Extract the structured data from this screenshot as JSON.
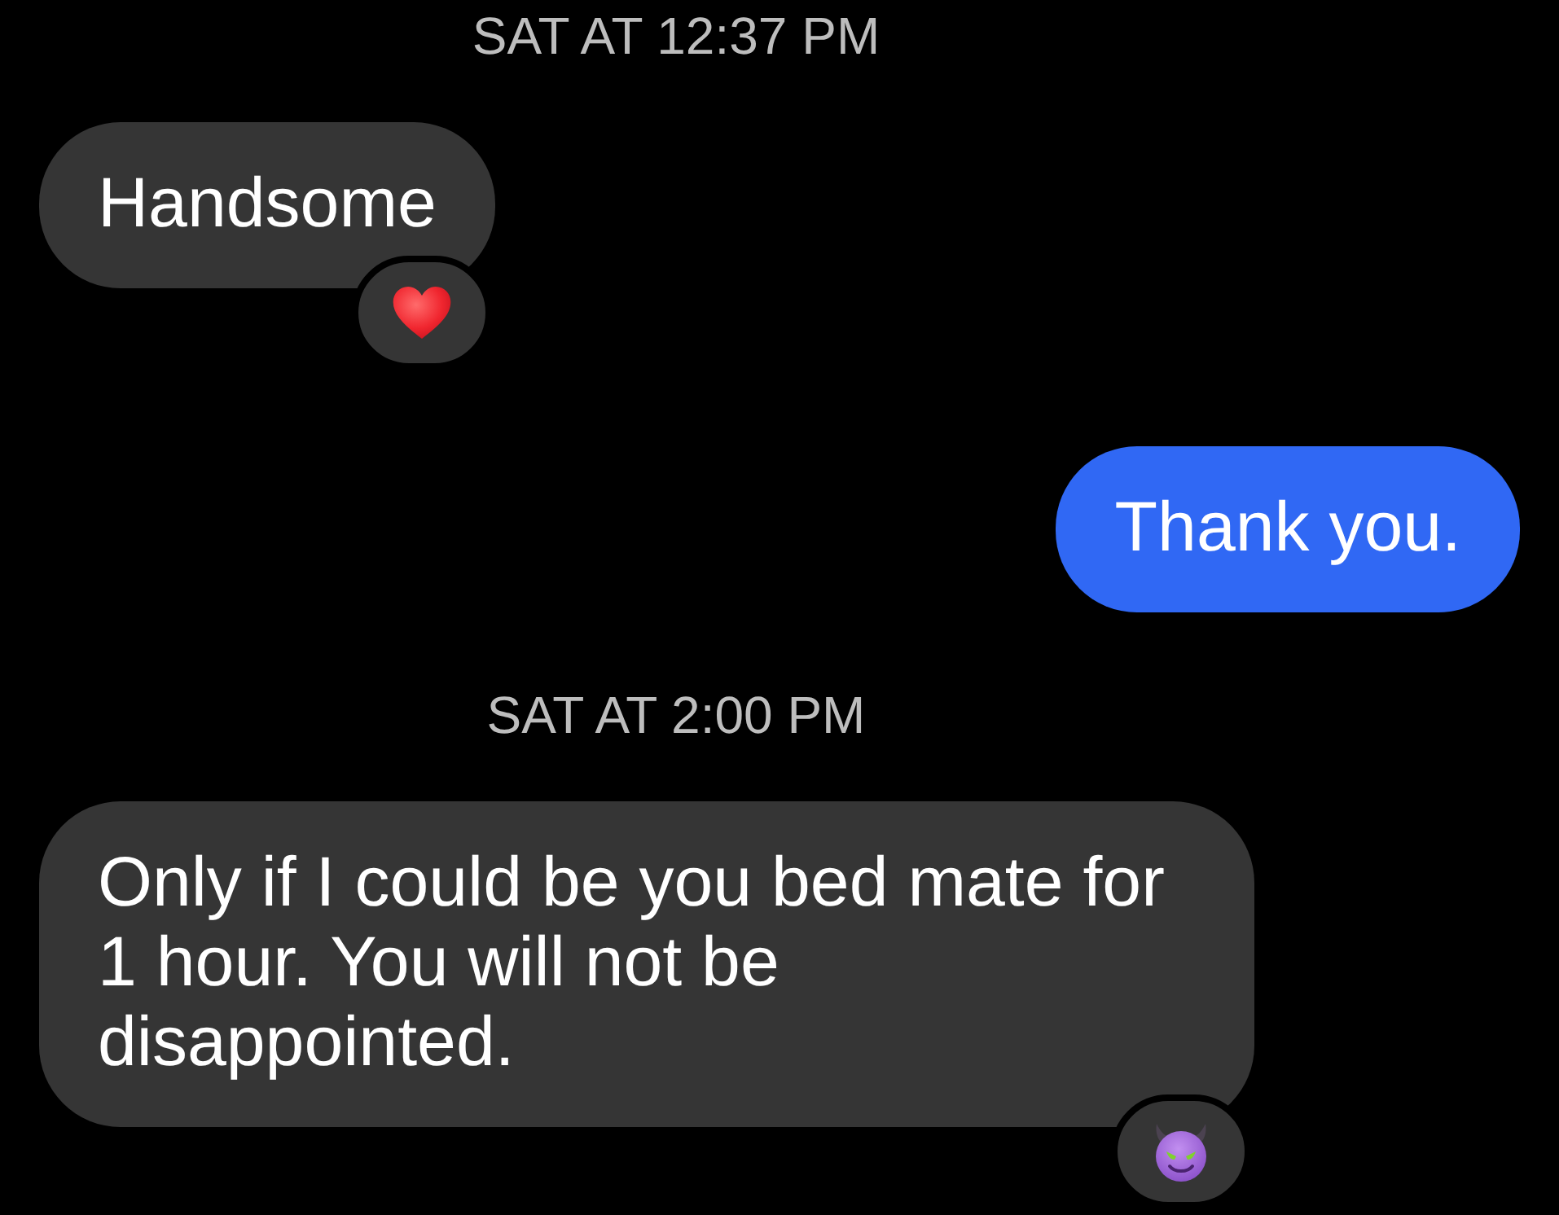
{
  "conversation": [
    {
      "kind": "timestamp",
      "text": "SAT AT 12:37 PM"
    },
    {
      "kind": "incoming",
      "text": "Handsome",
      "reaction": {
        "kind": "heart"
      }
    },
    {
      "kind": "outgoing",
      "text": "Thank you."
    },
    {
      "kind": "timestamp",
      "text": "SAT AT 2:00 PM"
    },
    {
      "kind": "incoming",
      "text": "Only if I could be you bed mate for 1 hour. You will not be disappointed.",
      "reaction": {
        "kind": "devil"
      }
    }
  ]
}
